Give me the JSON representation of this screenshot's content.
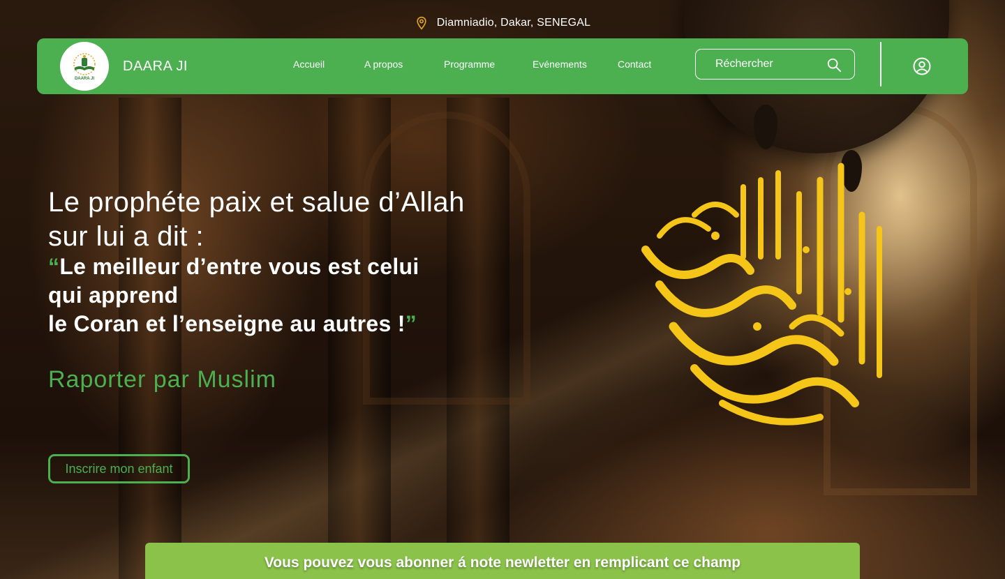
{
  "location": {
    "text": "Diamniadio, Dakar, SENEGAL",
    "icon": "map-pin-icon",
    "icon_color": "#e0a526"
  },
  "brand": {
    "name": "DAARA JI",
    "logo_text": "DAARA JI"
  },
  "nav": {
    "items": [
      {
        "label": "Accueil"
      },
      {
        "label": "A propos"
      },
      {
        "label": "Programme"
      },
      {
        "label": "Evénements"
      },
      {
        "label": "Contact"
      }
    ]
  },
  "search": {
    "placeholder": "Réchercher",
    "icon": "search-icon"
  },
  "user": {
    "icon": "user-circle-icon"
  },
  "hero": {
    "intro_line1": "Le prophéte  paix et salue d’Allah",
    "intro_line2": "sur lui a dit :",
    "quote_open": "“",
    "quote_line1": "Le meilleur d’entre vous est celui",
    "quote_line2": "qui apprend",
    "quote_line3": "le Coran et l’enseigne au autres !",
    "quote_close": "”",
    "source": "Raporter par Muslim",
    "cta_label": "Inscrire mon enfant"
  },
  "newsletter": {
    "text": "Vous pouvez vous abonner á note newletter en remplicant ce champ"
  },
  "colors": {
    "primary_green": "#4caf50",
    "newsletter_green": "#8bc34a",
    "calligraphy_gold": "#f5c518",
    "text_white": "#ffffff"
  }
}
